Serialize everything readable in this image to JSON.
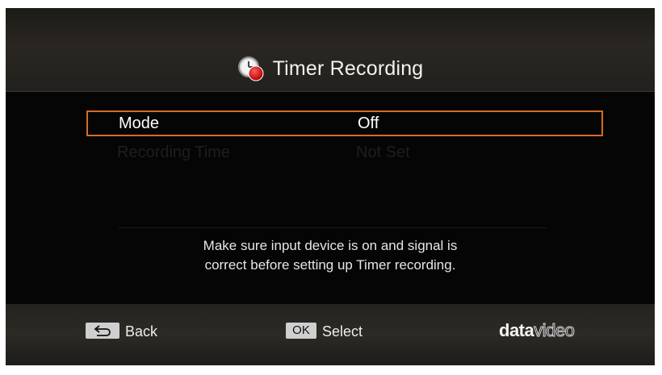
{
  "screen": {
    "title": "Timer Recording",
    "title_icon": "clock-record-icon"
  },
  "menu": {
    "items": [
      {
        "label": "Mode",
        "value": "Off",
        "selected": true
      },
      {
        "label": "Recording Time",
        "value": "Not Set",
        "selected": false
      }
    ]
  },
  "message": {
    "line1": "Make sure input device is on and signal is",
    "line2": "correct before setting up Timer recording."
  },
  "footer": {
    "back_key_icon": "return-arrow-icon",
    "back_label": "Back",
    "ok_key_label": "OK",
    "select_label": "Select",
    "brand_bold": "data",
    "brand_light": "video"
  },
  "colors": {
    "selection_border": "#d56c24",
    "record_red": "#d01818",
    "background": "#050505"
  }
}
